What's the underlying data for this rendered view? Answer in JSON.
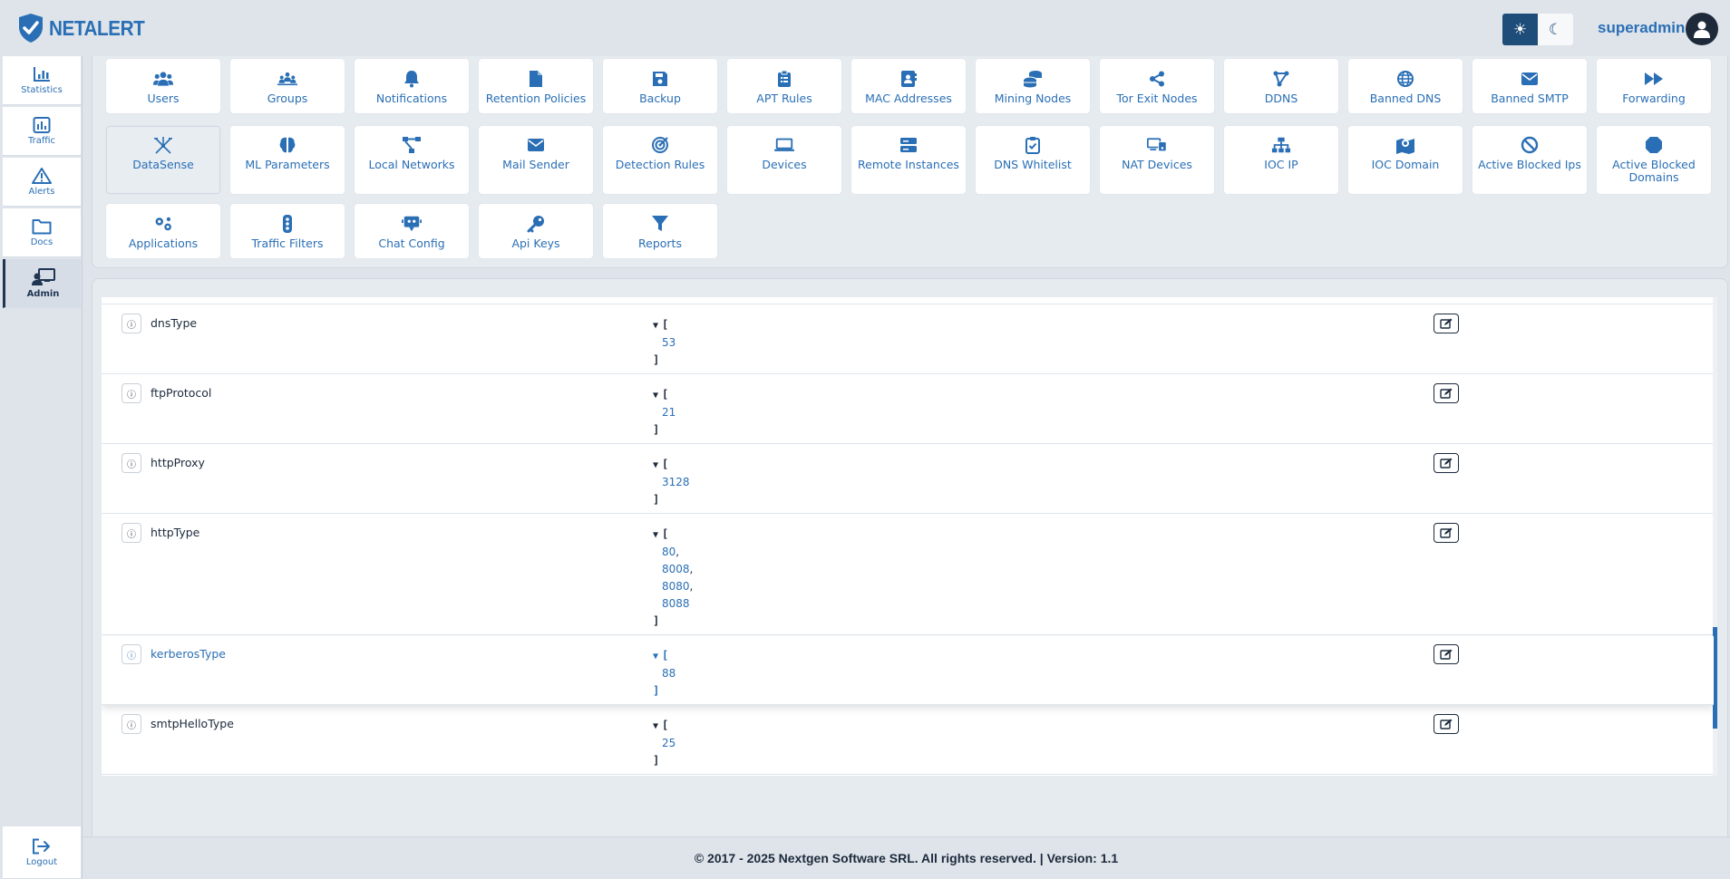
{
  "brand": {
    "name": "NETALERT"
  },
  "header": {
    "username": "superadmin",
    "theme_light_icon": "sun-icon",
    "theme_dark_icon": "moon-icon"
  },
  "sidebar": {
    "items": [
      {
        "label": "Statistics",
        "icon": "bar-chart-icon"
      },
      {
        "label": "Traffic",
        "icon": "chart-square-icon"
      },
      {
        "label": "Alerts",
        "icon": "warning-icon"
      },
      {
        "label": "Docs",
        "icon": "folder-icon"
      },
      {
        "label": "Admin",
        "icon": "admin-icon",
        "active": true
      }
    ],
    "logout": {
      "label": "Logout",
      "icon": "logout-icon"
    }
  },
  "admin_tiles": [
    {
      "label": "Users",
      "icon": "users-icon"
    },
    {
      "label": "Groups",
      "icon": "groups-icon"
    },
    {
      "label": "Notifications",
      "icon": "bell-icon"
    },
    {
      "label": "Retention Policies",
      "icon": "file-icon"
    },
    {
      "label": "Backup",
      "icon": "save-icon"
    },
    {
      "label": "APT Rules",
      "icon": "clipboard-list-icon"
    },
    {
      "label": "MAC Addresses",
      "icon": "address-book-icon"
    },
    {
      "label": "Mining Nodes",
      "icon": "coins-icon"
    },
    {
      "label": "Tor Exit Nodes",
      "icon": "share-icon"
    },
    {
      "label": "DDNS",
      "icon": "nodes-icon"
    },
    {
      "label": "Banned DNS",
      "icon": "globe-icon"
    },
    {
      "label": "Banned SMTP",
      "icon": "envelope-icon"
    },
    {
      "label": "Forwarding",
      "icon": "forward-icon"
    },
    {
      "label": "DataSense",
      "icon": "datasense-icon",
      "active": true
    },
    {
      "label": "ML Parameters",
      "icon": "brain-icon"
    },
    {
      "label": "Local Networks",
      "icon": "network-icon"
    },
    {
      "label": "Mail Sender",
      "icon": "envelope-icon"
    },
    {
      "label": "Detection Rules",
      "icon": "radar-icon"
    },
    {
      "label": "Devices",
      "icon": "laptop-icon"
    },
    {
      "label": "Remote Instances",
      "icon": "server-icon"
    },
    {
      "label": "DNS Whitelist",
      "icon": "clipboard-check-icon"
    },
    {
      "label": "NAT Devices",
      "icon": "devices-icon"
    },
    {
      "label": "IOC IP",
      "icon": "sitemap-icon"
    },
    {
      "label": "IOC Domain",
      "icon": "map-marker-icon"
    },
    {
      "label": "Active Blocked Ips",
      "icon": "ban-icon"
    },
    {
      "label": "Active Blocked Domains",
      "icon": "octagon-icon"
    },
    {
      "label": "Applications",
      "icon": "gears-icon"
    },
    {
      "label": "Traffic Filters",
      "icon": "traffic-light-icon"
    },
    {
      "label": "Chat Config",
      "icon": "chat-bot-icon"
    },
    {
      "label": "Api Keys",
      "icon": "key-icon"
    },
    {
      "label": "Reports",
      "icon": "filter-icon"
    }
  ],
  "settings_rows": [
    {
      "name": "dnsType",
      "values": [
        "53"
      ]
    },
    {
      "name": "ftpProtocol",
      "values": [
        "21"
      ]
    },
    {
      "name": "httpProxy",
      "values": [
        "3128"
      ]
    },
    {
      "name": "httpType",
      "values": [
        "80",
        "8008",
        "8080",
        "8088"
      ]
    },
    {
      "name": "kerberosType",
      "values": [
        "88"
      ],
      "highlighted": true
    },
    {
      "name": "smtpHelloType",
      "values": [
        "25"
      ]
    }
  ],
  "footer": {
    "text": "© 2017 - 2025 Nextgen Software SRL. All rights reserved. | Version: 1.1"
  }
}
